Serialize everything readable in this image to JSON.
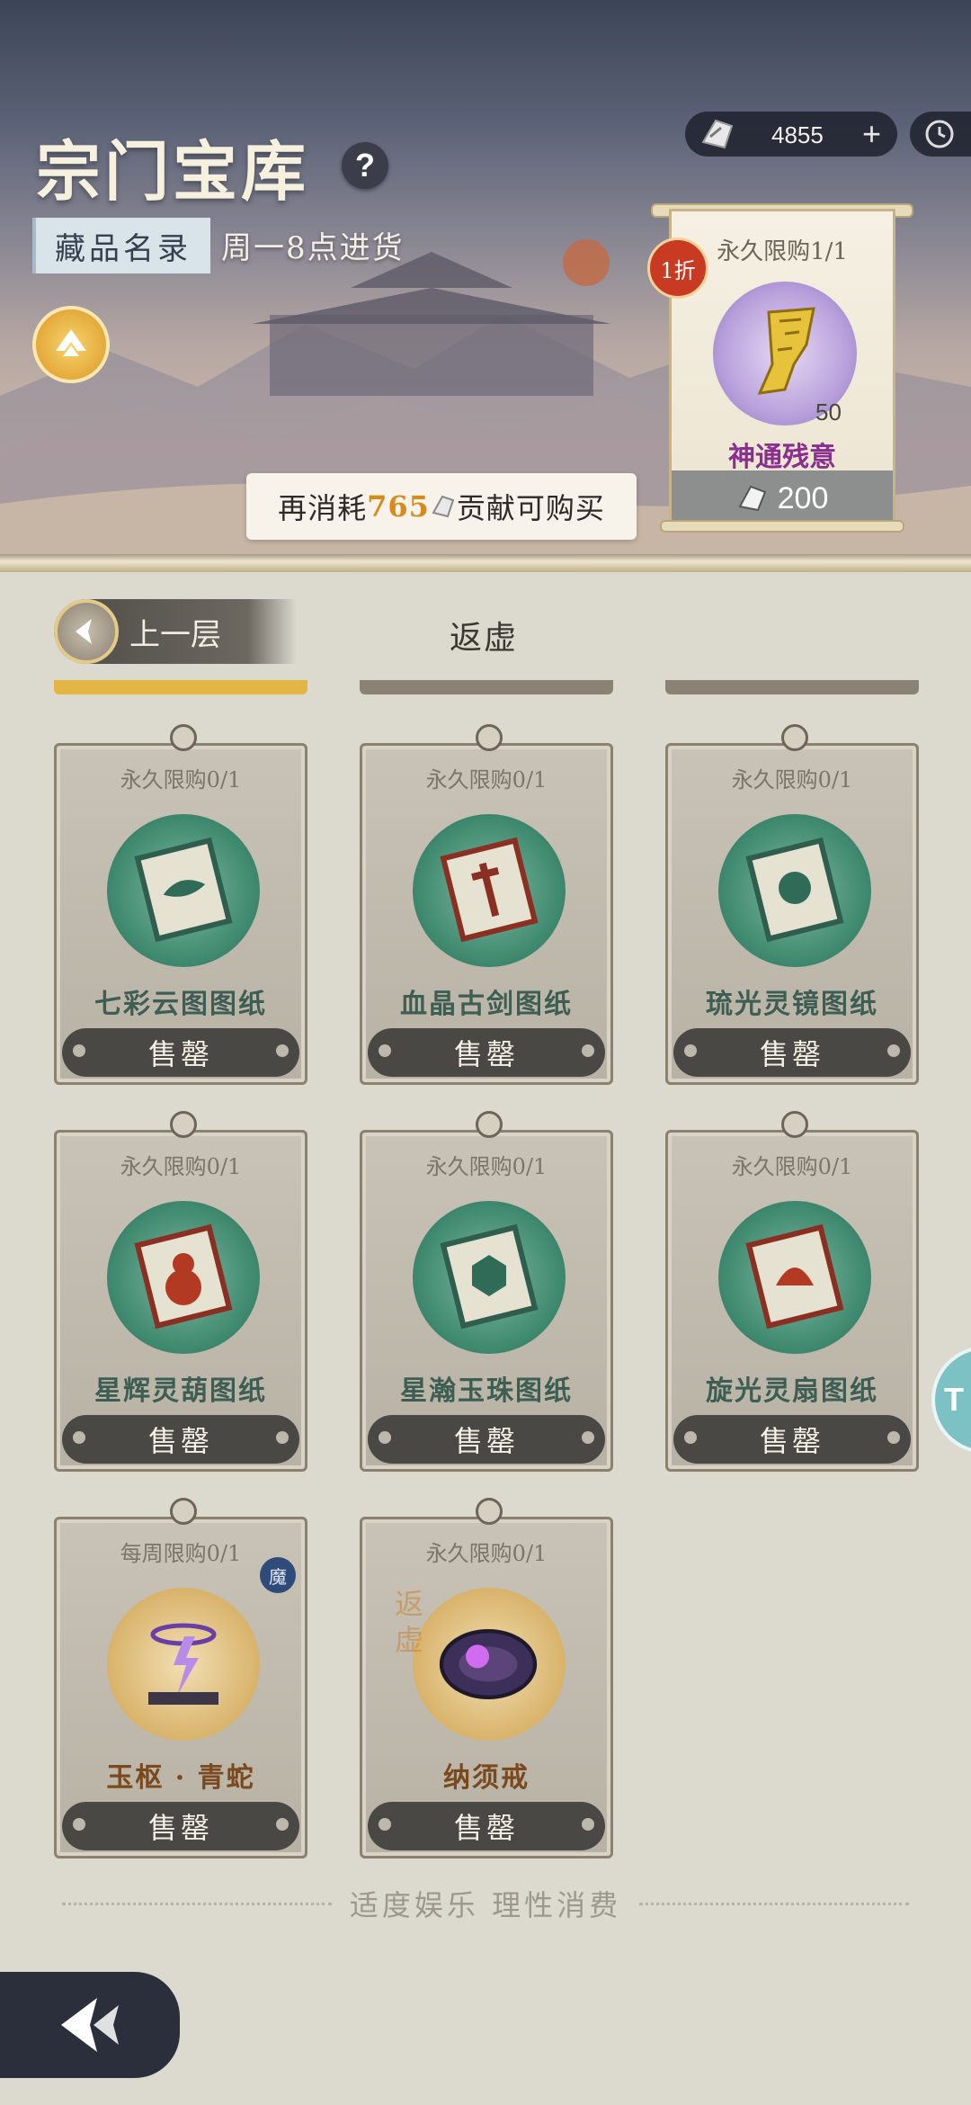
{
  "header": {
    "title": "宗门宝库",
    "help": "?",
    "catalog_tag": "藏品名录",
    "restock": "周一8点进货",
    "currency_amount": "4855",
    "currency_plus": "+",
    "consume": {
      "prefix": "再消耗",
      "amount": "765",
      "suffix": "贡献可购买"
    }
  },
  "featured": {
    "discount": "1折",
    "limit": "永久限购1/1",
    "quantity": "50",
    "name": "神通残意",
    "price": "200"
  },
  "nav": {
    "prev_label": "上一层",
    "layer_name": "返虚"
  },
  "items": [
    {
      "limit": "永久限购0/1",
      "name": "七彩云图图纸",
      "action": "售罄",
      "art": "scroll-green-fish"
    },
    {
      "limit": "永久限购0/1",
      "name": "血晶古剑图纸",
      "action": "售罄",
      "art": "scroll-red-sword"
    },
    {
      "limit": "永久限购0/1",
      "name": "琉光灵镜图纸",
      "action": "售罄",
      "art": "scroll-green-mirror"
    },
    {
      "limit": "永久限购0/1",
      "name": "星辉灵葫图纸",
      "action": "售罄",
      "art": "scroll-red-gourd"
    },
    {
      "limit": "永久限购0/1",
      "name": "星瀚玉珠图纸",
      "action": "售罄",
      "art": "scroll-green-pearl"
    },
    {
      "limit": "永久限购0/1",
      "name": "旋光灵扇图纸",
      "action": "售罄",
      "art": "scroll-red-fan"
    },
    {
      "limit": "每周限购0/1",
      "name": "玉枢 · 青蛇",
      "action": "售罄",
      "art": "purple-lightning",
      "badge": "魔"
    },
    {
      "limit": "永久限购0/1",
      "name": "纳须戒",
      "action": "售罄",
      "art": "purple-ring",
      "watermark": "返虚"
    }
  ],
  "footer": {
    "notice": "适度娱乐 理性消费"
  },
  "side_tab": "T"
}
